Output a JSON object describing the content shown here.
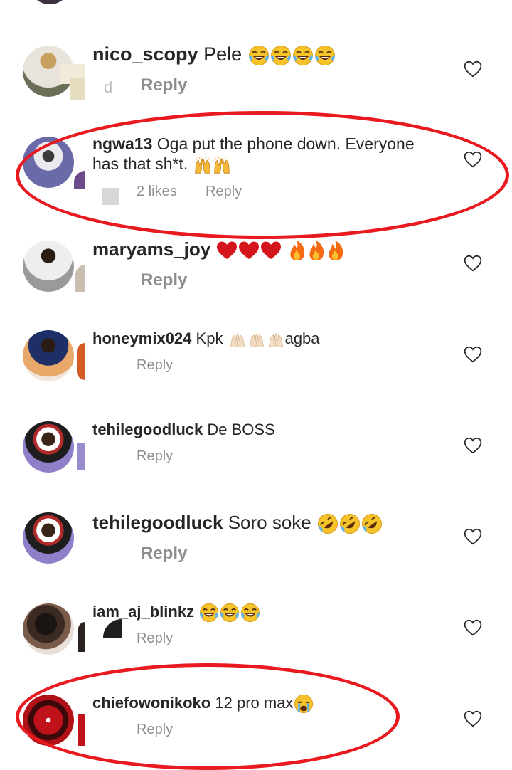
{
  "comments": [
    {
      "username": "nico_scopy",
      "text": "Pele",
      "reply": "Reply",
      "meta_prefix": "d"
    },
    {
      "username": "ngwa13",
      "text": "Oga put the phone down.  Everyone has that sh*t.",
      "likes": "2 likes",
      "reply": "Reply"
    },
    {
      "username": "maryams_joy",
      "text": "",
      "reply": "Reply"
    },
    {
      "username": "honeymix024",
      "text": "Kpk",
      "text_after": "agba",
      "reply": "Reply"
    },
    {
      "username": "tehilegoodluck",
      "text": "De BOSS",
      "reply": "Reply"
    },
    {
      "username": "tehilegoodluck",
      "text": "Soro soke",
      "reply": "Reply"
    },
    {
      "username": "iam_aj_blinkz",
      "text": "",
      "reply": "Reply"
    },
    {
      "username": "chiefowonikoko",
      "text": "12 pro max",
      "reply": "Reply"
    }
  ],
  "emoji": {
    "laugh": "tears-of-joy-emoji",
    "praise": "raised-hands-emoji",
    "heart": "red-heart-emoji",
    "fire": "fire-emoji",
    "clap": "clapping-hands-emoji",
    "rofl": "rolling-laughing-emoji",
    "cry": "crying-face-emoji"
  },
  "colors": {
    "accent_ring": "#e8191f",
    "muted": "#8e8e8e",
    "text": "#262626"
  }
}
